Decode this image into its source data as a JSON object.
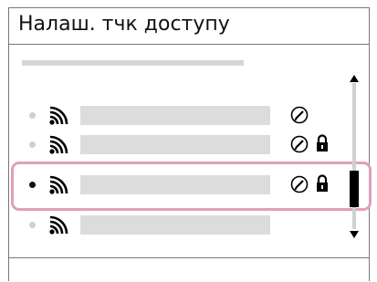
{
  "screen": {
    "title": "Налаш. тчк доступу"
  },
  "access_points": [
    {
      "icon": "wifi-icon",
      "status_icon": "edit-settings-icon",
      "secured": false,
      "selected": false
    },
    {
      "icon": "wifi-icon",
      "status_icon": "edit-settings-icon",
      "secured": true,
      "selected": false
    },
    {
      "icon": "wifi-icon",
      "status_icon": "edit-settings-icon",
      "secured": true,
      "selected": true
    },
    {
      "icon": "wifi-icon",
      "status_icon": null,
      "secured": false,
      "selected": false
    }
  ],
  "colors": {
    "selection_frame": "#e0a0bd",
    "placeholder_bar": "#dcdcdc",
    "border": "#777777"
  }
}
